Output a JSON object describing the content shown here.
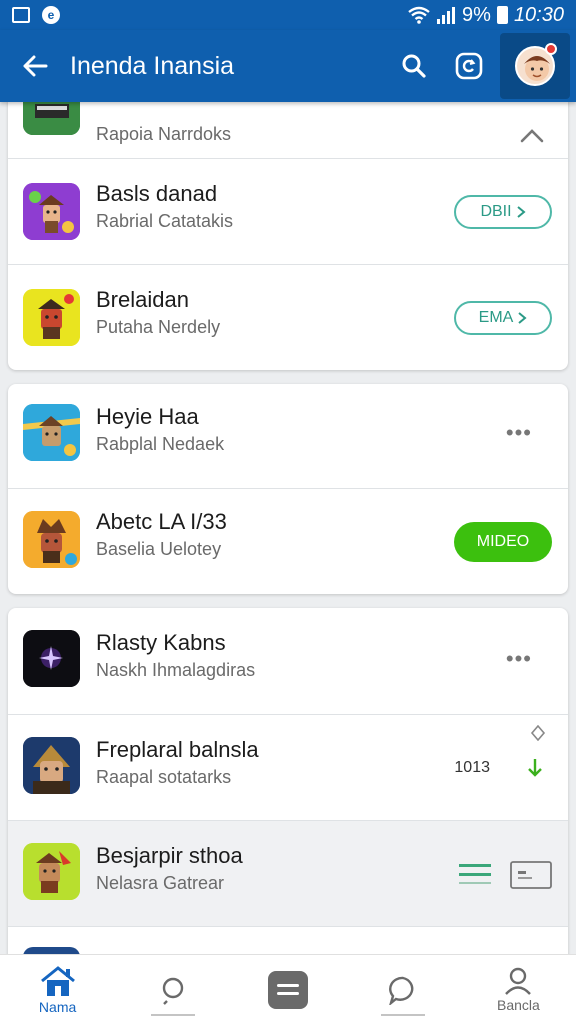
{
  "status_bar": {
    "battery": "%",
    "time": "10:30",
    "battery_percent": "9%"
  },
  "app_bar": {
    "title": "Inenda Inansia"
  },
  "cards": [
    {
      "rows": [
        {
          "name": "",
          "subtitle": "Rapoia Narrdoks",
          "action": "collapse"
        },
        {
          "name": "Basls danad",
          "subtitle": "Rabrial Catatakis",
          "action": "pill",
          "button_label": "DBII"
        },
        {
          "name": "Brelaidan",
          "subtitle": "Putaha Nerdely",
          "action": "pill",
          "button_label": "EMA"
        }
      ]
    },
    {
      "rows": [
        {
          "name": "Heyie Haa",
          "subtitle": "Rabplal Nedaek",
          "action": "more"
        },
        {
          "name": "Abetc LA I/33",
          "subtitle": "Baselia Uelotey",
          "action": "green",
          "button_label": "MIDEO"
        }
      ]
    },
    {
      "rows": [
        {
          "name": "Rlasty Kabns",
          "subtitle": "Naskh Ihmalagdiras",
          "action": "more"
        },
        {
          "name": "Freplaral balnsla",
          "subtitle": "Raapal sotatarks",
          "action": "download",
          "size_label": "1013"
        },
        {
          "name": "Besjarpir sthoa",
          "subtitle": "Nelasra Gatrear",
          "action": "queue"
        }
      ]
    }
  ],
  "bottom_nav": [
    {
      "label": "Nama",
      "active": true
    },
    {
      "label": ""
    },
    {
      "label": ""
    },
    {
      "label": ""
    },
    {
      "label": "Bancla"
    }
  ],
  "colors": {
    "primary": "#0f5fae",
    "accent_green": "#3cc00e",
    "teal": "#4fb8a8"
  }
}
